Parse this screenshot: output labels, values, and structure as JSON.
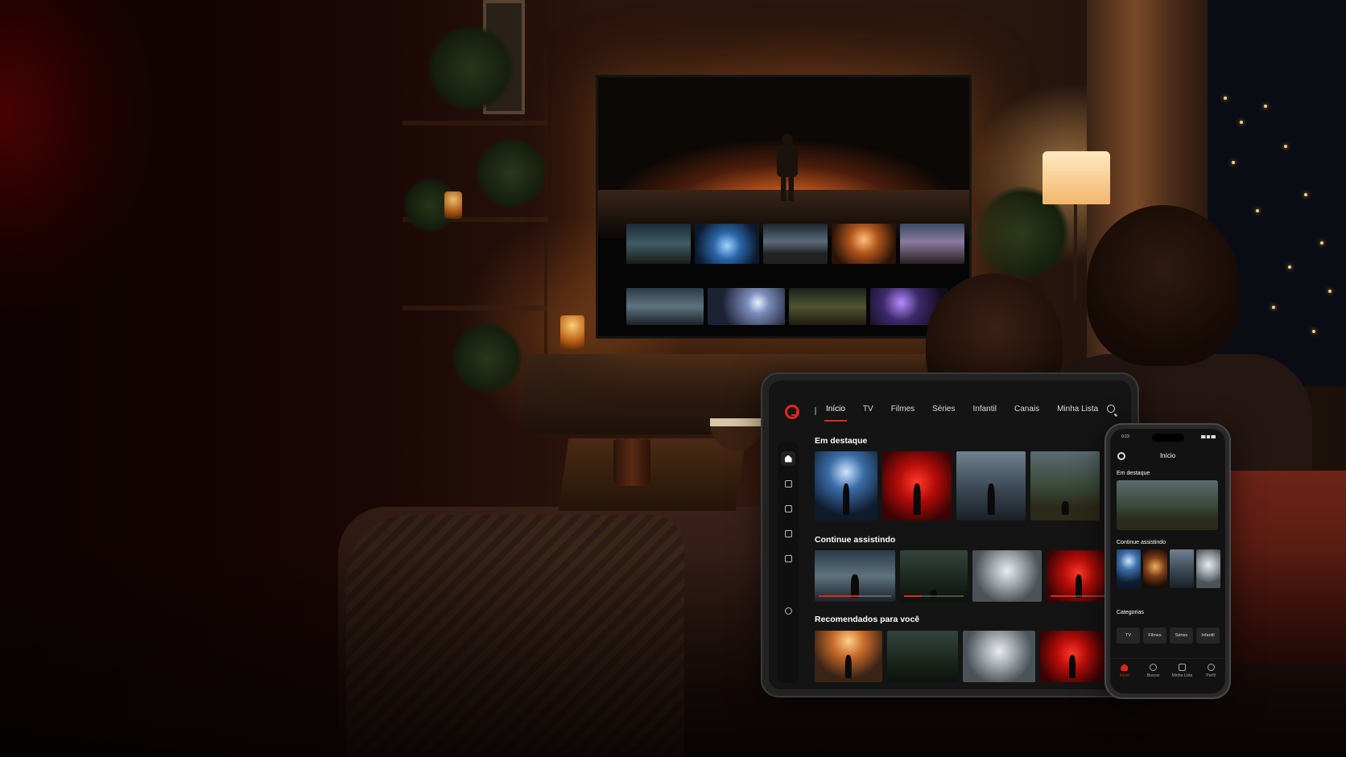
{
  "tablet": {
    "nav": [
      "Início",
      "TV",
      "Filmes",
      "Séries",
      "Infantil",
      "Canais",
      "Minha Lista"
    ],
    "active_nav": "Início",
    "sections": {
      "featured": "Em destaque",
      "continue": "Continue assistindo",
      "recommended": "Recomendados para você"
    },
    "continue_progress": [
      0.55,
      0.3,
      0.0,
      0.35
    ]
  },
  "phone": {
    "status_time": "0:23",
    "title": "Início",
    "sections": {
      "featured": "Em destaque",
      "continue": "Continue assistindo",
      "categories": "Categorias"
    },
    "categories": [
      "TV",
      "Filmes",
      "Séries",
      "Infantil"
    ],
    "tabbar": [
      {
        "label": "Início",
        "icon": "home-icon",
        "active": true
      },
      {
        "label": "Buscar",
        "icon": "search-icon",
        "active": false
      },
      {
        "label": "Minha Lista",
        "icon": "list-icon",
        "active": false
      },
      {
        "label": "Perfil",
        "icon": "profile-icon",
        "active": false
      }
    ]
  },
  "colors": {
    "accent": "#e3261c",
    "background": "#141414"
  }
}
